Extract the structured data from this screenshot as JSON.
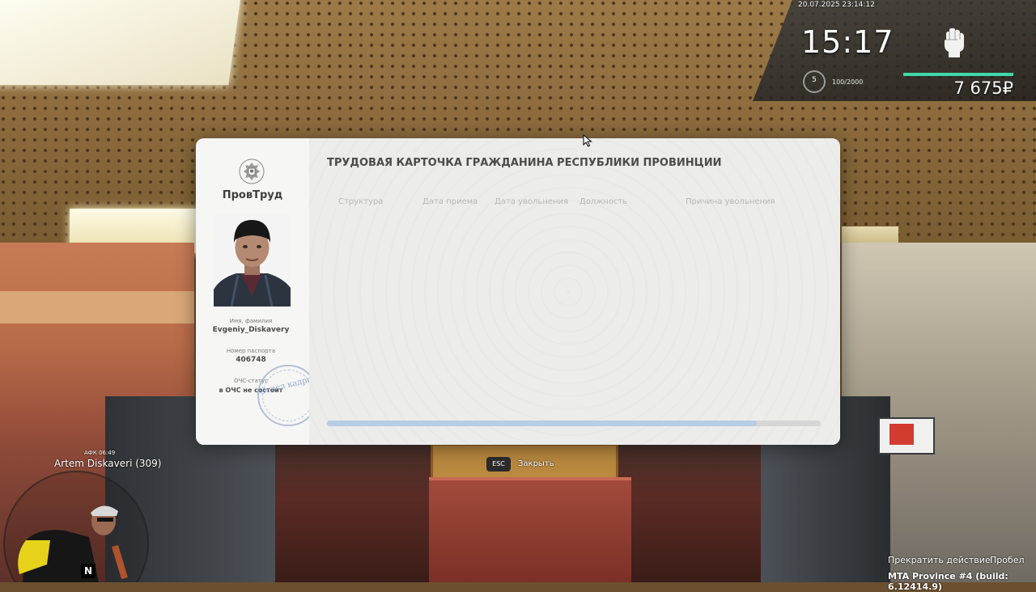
{
  "hud": {
    "datetime": "20.07.2025 23:14:12",
    "clock": "15:17",
    "level": "5",
    "xp": "100/2000",
    "health_fraction": 1.0,
    "money": "7 675₽",
    "health_color": "#3fd9a8"
  },
  "card": {
    "brand": "ПровТруд",
    "title": "ТРУДОВАЯ КАРТОЧКА ГРАЖДАНИНА РЕСПУБЛИКИ ПРОВИНЦИИ",
    "name_label": "Имя, фамилия",
    "name_value": "Evgeniy_Diskavery",
    "passport_label": "Номер паспорта",
    "passport_value": "406748",
    "ochs_label": "ОЧС-статус",
    "ochs_value": "в ОЧС не состоит",
    "stamp_text": "Отдел кадров",
    "columns": [
      "Структура",
      "Дата приема",
      "Дата увольнения",
      "Должность",
      "Причина увольнения"
    ],
    "rows": [],
    "scroll_fraction": 0.87
  },
  "hints": {
    "esc_key": "ESC",
    "esc_label": "Закрыть"
  },
  "player": {
    "afk": "АФК 06:49",
    "name": "Artem Diskaveri (309)",
    "radar_north": "N"
  },
  "actions": {
    "stop": "Прекратить действие",
    "run": "Пробел"
  },
  "build": "MTA Province #4 (build: 6.12414.9)"
}
